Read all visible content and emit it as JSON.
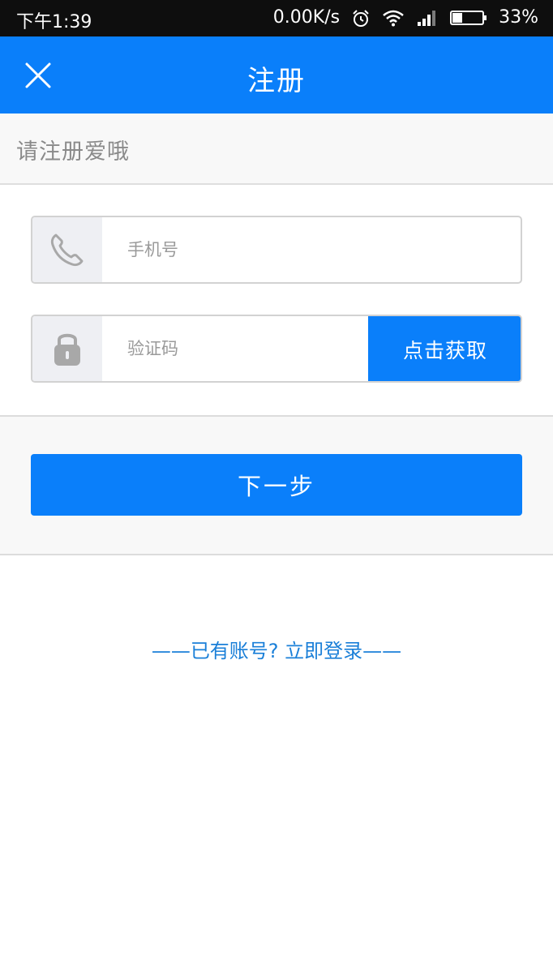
{
  "status_bar": {
    "time": "下午1:39",
    "network_speed": "0.00K/s",
    "battery": "33%",
    "icons": [
      "alarm-icon",
      "wifi-icon",
      "signal-icon",
      "battery-icon"
    ]
  },
  "header": {
    "title": "注册",
    "close_icon": "close-icon"
  },
  "subtitle": "请注册爱哦",
  "form": {
    "phone": {
      "placeholder": "手机号",
      "value": "",
      "icon": "phone-icon"
    },
    "code": {
      "placeholder": "验证码",
      "value": "",
      "icon": "lock-icon",
      "button_label": "点击获取"
    }
  },
  "next_button": "下一步",
  "login_link": "——已有账号? 立即登录——",
  "colors": {
    "primary": "#0a7ffa",
    "link": "#1a7fd8",
    "status_bar": "#0e0e0e",
    "band_bg": "#f8f8f8"
  }
}
